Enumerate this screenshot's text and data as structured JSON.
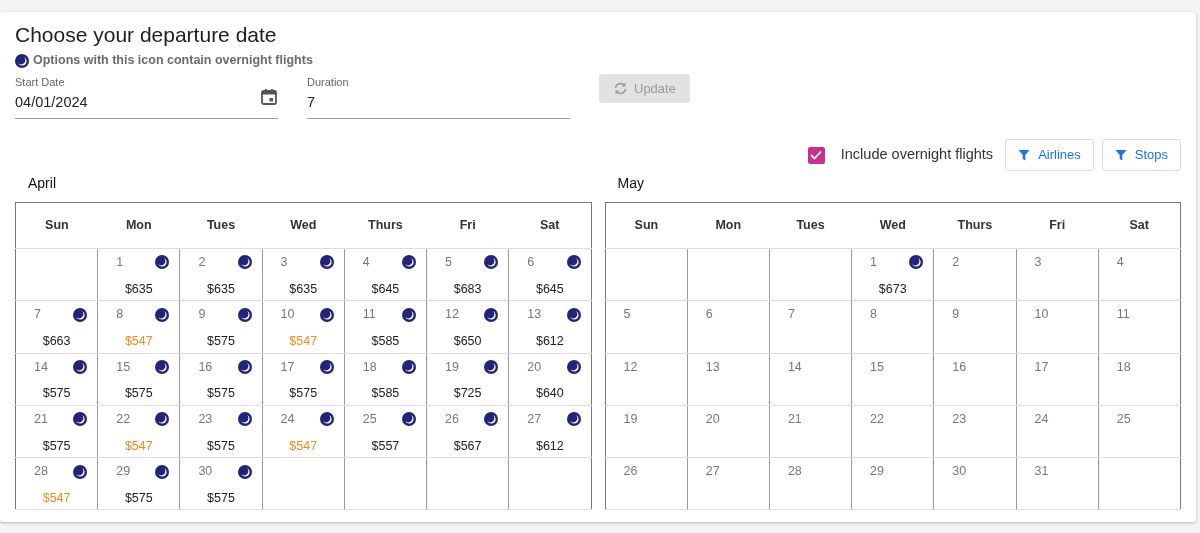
{
  "title": "Choose your departure date",
  "legend": "Options with this icon contain overnight flights",
  "start_date": {
    "label": "Start Date",
    "value": "04/01/2024"
  },
  "duration": {
    "label": "Duration",
    "value": "7"
  },
  "update_button": {
    "label": "Update",
    "disabled": true
  },
  "overnight_checkbox": {
    "label": "Include overnight flights",
    "checked": true
  },
  "filter_buttons": [
    "Airlines",
    "Stops"
  ],
  "months": [
    {
      "name": "April",
      "weekdays": [
        "Sun",
        "Mon",
        "Tues",
        "Wed",
        "Thurs",
        "Fri",
        "Sat"
      ],
      "weeks": [
        [
          {
            "kind": "blank"
          },
          {
            "kind": "day",
            "day": "1",
            "price": "$635",
            "overnight": true,
            "lowest": false
          },
          {
            "kind": "day",
            "day": "2",
            "price": "$635",
            "overnight": true,
            "lowest": false
          },
          {
            "kind": "day",
            "day": "3",
            "price": "$635",
            "overnight": true,
            "lowest": false
          },
          {
            "kind": "day",
            "day": "4",
            "price": "$645",
            "overnight": true,
            "lowest": false
          },
          {
            "kind": "day",
            "day": "5",
            "price": "$683",
            "overnight": true,
            "lowest": false
          },
          {
            "kind": "day",
            "day": "6",
            "price": "$645",
            "overnight": true,
            "lowest": false
          }
        ],
        [
          {
            "kind": "day",
            "day": "7",
            "price": "$663",
            "overnight": true,
            "lowest": false
          },
          {
            "kind": "day",
            "day": "8",
            "price": "$547",
            "overnight": true,
            "lowest": true
          },
          {
            "kind": "day",
            "day": "9",
            "price": "$575",
            "overnight": true,
            "lowest": false
          },
          {
            "kind": "day",
            "day": "10",
            "price": "$547",
            "overnight": true,
            "lowest": true
          },
          {
            "kind": "day",
            "day": "11",
            "price": "$585",
            "overnight": true,
            "lowest": false
          },
          {
            "kind": "day",
            "day": "12",
            "price": "$650",
            "overnight": true,
            "lowest": false
          },
          {
            "kind": "day",
            "day": "13",
            "price": "$612",
            "overnight": true,
            "lowest": false
          }
        ],
        [
          {
            "kind": "day",
            "day": "14",
            "price": "$575",
            "overnight": true,
            "lowest": false
          },
          {
            "kind": "day",
            "day": "15",
            "price": "$575",
            "overnight": true,
            "lowest": false
          },
          {
            "kind": "day",
            "day": "16",
            "price": "$575",
            "overnight": true,
            "lowest": false
          },
          {
            "kind": "day",
            "day": "17",
            "price": "$575",
            "overnight": true,
            "lowest": false
          },
          {
            "kind": "day",
            "day": "18",
            "price": "$585",
            "overnight": true,
            "lowest": false
          },
          {
            "kind": "day",
            "day": "19",
            "price": "$725",
            "overnight": true,
            "lowest": false
          },
          {
            "kind": "day",
            "day": "20",
            "price": "$640",
            "overnight": true,
            "lowest": false
          }
        ],
        [
          {
            "kind": "day",
            "day": "21",
            "price": "$575",
            "overnight": true,
            "lowest": false
          },
          {
            "kind": "day",
            "day": "22",
            "price": "$547",
            "overnight": true,
            "lowest": true
          },
          {
            "kind": "day",
            "day": "23",
            "price": "$575",
            "overnight": true,
            "lowest": false
          },
          {
            "kind": "day",
            "day": "24",
            "price": "$547",
            "overnight": true,
            "lowest": true
          },
          {
            "kind": "day",
            "day": "25",
            "price": "$557",
            "overnight": true,
            "lowest": false
          },
          {
            "kind": "day",
            "day": "26",
            "price": "$567",
            "overnight": true,
            "lowest": false
          },
          {
            "kind": "day",
            "day": "27",
            "price": "$612",
            "overnight": true,
            "lowest": false
          }
        ],
        [
          {
            "kind": "day",
            "day": "28",
            "price": "$547",
            "overnight": true,
            "lowest": true
          },
          {
            "kind": "day",
            "day": "29",
            "price": "$575",
            "overnight": true,
            "lowest": false
          },
          {
            "kind": "day",
            "day": "30",
            "price": "$575",
            "overnight": true,
            "lowest": false
          },
          {
            "kind": "blank"
          },
          {
            "kind": "blank"
          },
          {
            "kind": "blank"
          },
          {
            "kind": "blank"
          }
        ]
      ]
    },
    {
      "name": "May",
      "weekdays": [
        "Sun",
        "Mon",
        "Tues",
        "Wed",
        "Thurs",
        "Fri",
        "Sat"
      ],
      "weeks": [
        [
          {
            "kind": "blank"
          },
          {
            "kind": "blank"
          },
          {
            "kind": "blank"
          },
          {
            "kind": "day",
            "day": "1",
            "price": "$673",
            "overnight": true,
            "lowest": false
          },
          {
            "kind": "day",
            "day": "2",
            "overnight": false
          },
          {
            "kind": "day",
            "day": "3",
            "overnight": false
          },
          {
            "kind": "day",
            "day": "4",
            "overnight": false
          }
        ],
        [
          {
            "kind": "day",
            "day": "5",
            "overnight": false
          },
          {
            "kind": "day",
            "day": "6",
            "overnight": false
          },
          {
            "kind": "day",
            "day": "7",
            "overnight": false
          },
          {
            "kind": "day",
            "day": "8",
            "overnight": false
          },
          {
            "kind": "day",
            "day": "9",
            "overnight": false
          },
          {
            "kind": "day",
            "day": "10",
            "overnight": false
          },
          {
            "kind": "day",
            "day": "11",
            "overnight": false
          }
        ],
        [
          {
            "kind": "day",
            "day": "12",
            "overnight": false
          },
          {
            "kind": "day",
            "day": "13",
            "overnight": false
          },
          {
            "kind": "day",
            "day": "14",
            "overnight": false
          },
          {
            "kind": "day",
            "day": "15",
            "overnight": false
          },
          {
            "kind": "day",
            "day": "16",
            "overnight": false
          },
          {
            "kind": "day",
            "day": "17",
            "overnight": false
          },
          {
            "kind": "day",
            "day": "18",
            "overnight": false
          }
        ],
        [
          {
            "kind": "day",
            "day": "19",
            "overnight": false
          },
          {
            "kind": "day",
            "day": "20",
            "overnight": false
          },
          {
            "kind": "day",
            "day": "21",
            "overnight": false
          },
          {
            "kind": "day",
            "day": "22",
            "overnight": false
          },
          {
            "kind": "day",
            "day": "23",
            "overnight": false
          },
          {
            "kind": "day",
            "day": "24",
            "overnight": false
          },
          {
            "kind": "day",
            "day": "25",
            "overnight": false
          }
        ],
        [
          {
            "kind": "day",
            "day": "26",
            "overnight": false
          },
          {
            "kind": "day",
            "day": "27",
            "overnight": false
          },
          {
            "kind": "day",
            "day": "28",
            "overnight": false
          },
          {
            "kind": "day",
            "day": "29",
            "overnight": false
          },
          {
            "kind": "day",
            "day": "30",
            "overnight": false
          },
          {
            "kind": "day",
            "day": "31",
            "overnight": false
          },
          {
            "kind": "blank"
          }
        ]
      ]
    }
  ]
}
